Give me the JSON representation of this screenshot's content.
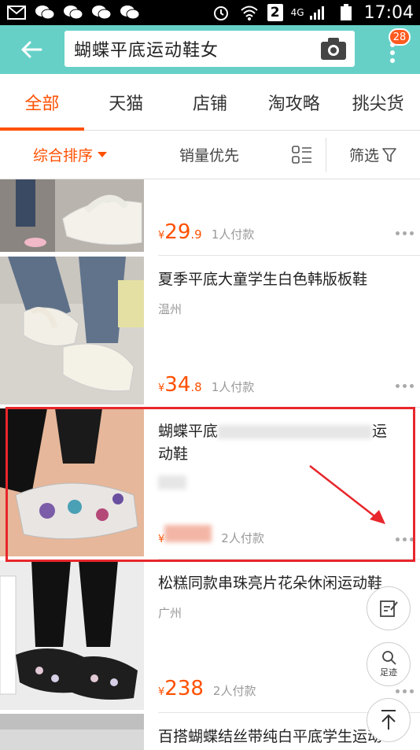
{
  "status_bar": {
    "sim_slot": "2",
    "network": "4G",
    "time": "17:04"
  },
  "search": {
    "query": "蝴蝶平底运动鞋女"
  },
  "header": {
    "notification_count": "28"
  },
  "tabs": [
    {
      "label": "全部"
    },
    {
      "label": "天猫"
    },
    {
      "label": "店铺"
    },
    {
      "label": "淘攻略"
    },
    {
      "label": "挑尖货"
    }
  ],
  "filters": {
    "sort": "综合排序",
    "sales": "销量优先",
    "filter": "筛选"
  },
  "products": [
    {
      "title": "",
      "location": "",
      "price_int": "29",
      "price_dec": ".9",
      "paid": "1人付款"
    },
    {
      "title": "夏季平底大童学生白色韩版板鞋",
      "location": "温州",
      "price_int": "34",
      "price_dec": ".8",
      "paid": "1人付款"
    },
    {
      "title_start": "蝴蝶平底",
      "title_end": "运",
      "title_line2": "动鞋",
      "location": "",
      "price_int": "",
      "price_dec": "",
      "paid": "2人付款"
    },
    {
      "title": "松糕同款串珠亮片花朵休闲运动鞋",
      "location": "广州",
      "price_int": "238",
      "price_dec": "",
      "paid": "2人付款"
    },
    {
      "title": "百搭蝴蝶结丝带纯白平底学生运动",
      "location": "",
      "price_int": "",
      "price_dec": "",
      "paid": ""
    }
  ],
  "currency_symbol": "¥",
  "fabs": {
    "footprint_label": "足迹"
  },
  "colors": {
    "header_bg": "#66d0c7",
    "accent": "#ff5000",
    "highlight": "#e8262b"
  }
}
